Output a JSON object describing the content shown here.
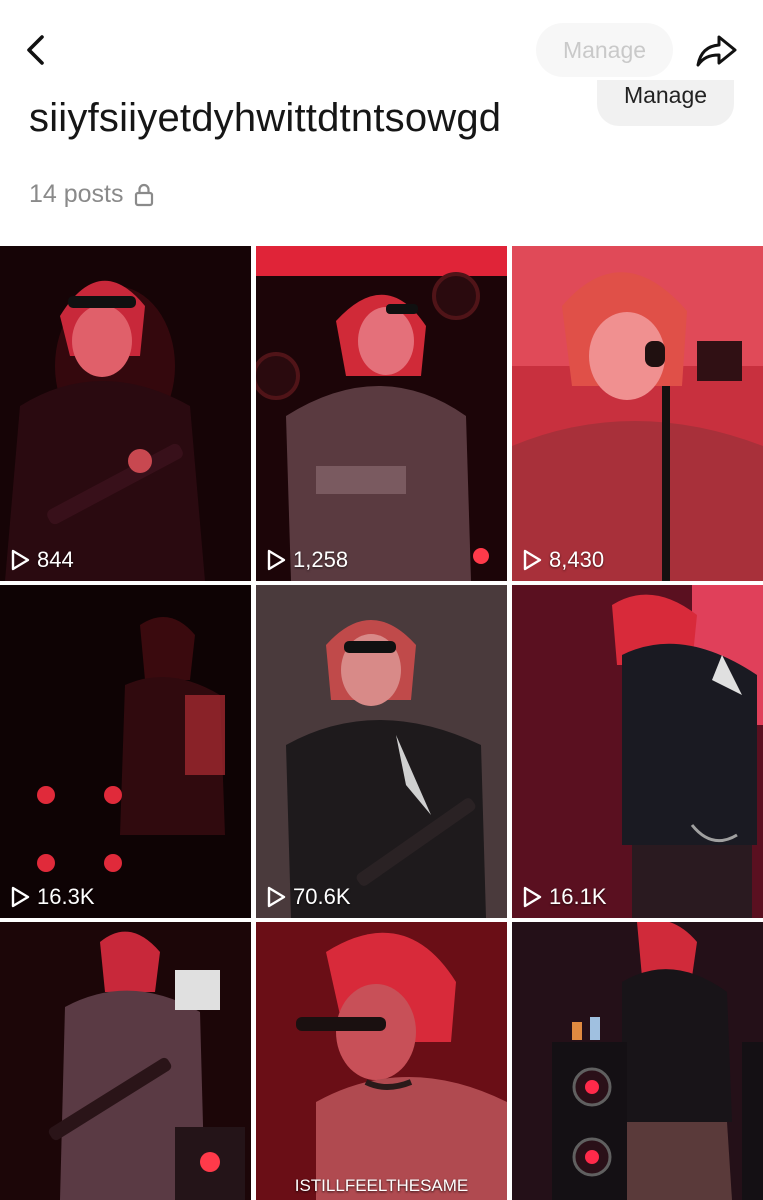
{
  "header": {
    "manage_faded_label": "Manage",
    "manage_label": "Manage",
    "title": "siiyfsiiyetdyhwittdtntsowgd",
    "post_count": "14 posts",
    "icons": [
      "back-arrow-icon",
      "share-arrow-icon",
      "lock-icon",
      "play-icon"
    ]
  },
  "grid": {
    "tiles": [
      {
        "views": "844"
      },
      {
        "views": "1,258"
      },
      {
        "views": "8,430"
      },
      {
        "views": "16.3K"
      },
      {
        "views": "70.6K"
      },
      {
        "views": "16.1K"
      },
      {
        "views": ""
      },
      {
        "views": "",
        "caption": "ISTILLFEELTHESAME"
      },
      {
        "views": ""
      }
    ]
  },
  "colors": {
    "background": "#ffffff",
    "title_text": "#161616",
    "meta_text": "#8a8a8a",
    "manage_bg": "#f1f1f1",
    "stage_red": "#d8203a",
    "stage_dark": "#1a0608"
  }
}
